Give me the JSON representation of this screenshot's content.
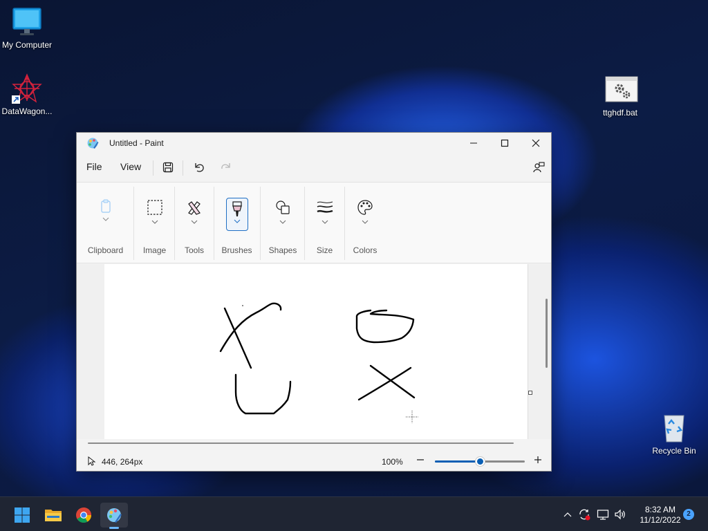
{
  "desktop": {
    "icons": [
      {
        "label": "My Computer"
      },
      {
        "label": "DataWagon..."
      },
      {
        "label": "ttghdf.bat"
      },
      {
        "label": "Recycle Bin"
      }
    ]
  },
  "paint": {
    "title": "Untitled - Paint",
    "menu": {
      "file": "File",
      "view": "View"
    },
    "ribbon": {
      "groups": [
        {
          "label": "Clipboard"
        },
        {
          "label": "Image"
        },
        {
          "label": "Tools"
        },
        {
          "label": "Brushes"
        },
        {
          "label": "Shapes"
        },
        {
          "label": "Size"
        },
        {
          "label": "Colors"
        }
      ]
    },
    "status": {
      "cursor_position": "446, 264px",
      "zoom_level": "100%",
      "zoom_fraction": 0.5
    }
  },
  "taskbar": {
    "apps": [
      {
        "icon": "windows-start-icon"
      },
      {
        "icon": "file-explorer-icon"
      },
      {
        "icon": "chrome-icon"
      },
      {
        "icon": "paint-icon"
      }
    ],
    "clock": {
      "time": "8:32 AM",
      "date": "11/12/2022"
    },
    "notification_count": "2"
  },
  "colors": {
    "accent": "#0a5fb4",
    "title_text": "#1a1a1a"
  }
}
